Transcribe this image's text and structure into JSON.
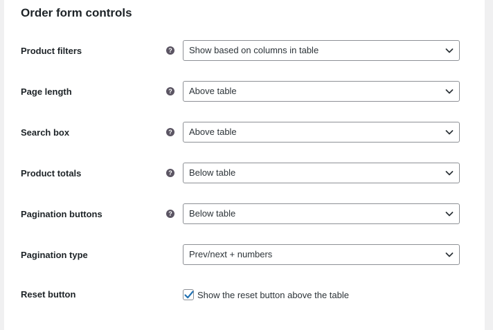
{
  "section": {
    "title": "Order form controls"
  },
  "fields": [
    {
      "label": "Product filters",
      "has_help": true,
      "value": "Show based on columns in table"
    },
    {
      "label": "Page length",
      "has_help": true,
      "value": "Above table"
    },
    {
      "label": "Search box",
      "has_help": true,
      "value": "Above table"
    },
    {
      "label": "Product totals",
      "has_help": true,
      "value": "Below table"
    },
    {
      "label": "Pagination buttons",
      "has_help": true,
      "value": "Below table"
    },
    {
      "label": "Pagination type",
      "has_help": false,
      "value": "Prev/next + numbers"
    }
  ],
  "reset_button": {
    "label": "Reset button",
    "checkbox_label": "Show the reset button above the table",
    "checked": true
  },
  "help_glyph": "?",
  "icons": {
    "help": "question-circle-icon",
    "dropdown": "chevron-down-icon",
    "check": "checkmark-icon"
  },
  "colors": {
    "check_accent": "#2271b1",
    "help_icon_bg": "#5b5563",
    "border": "#8c8f94"
  }
}
